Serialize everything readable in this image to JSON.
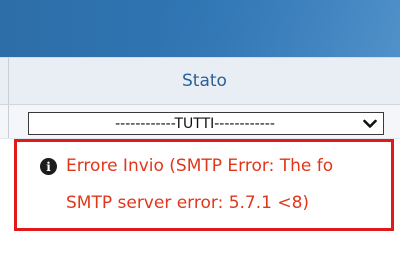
{
  "table": {
    "column_header": "Stato",
    "filter": {
      "selected_value": "------------TUTTI------------"
    }
  },
  "error": {
    "line1": "Errore Invio (SMTP Error: The fo",
    "line2": "SMTP server error: 5.7.1 <8)",
    "icon": "info-circle-icon",
    "text_color": "#e2361a",
    "highlight_color": "#e01a1a"
  },
  "colors": {
    "header_blue": "#2f76b5",
    "column_header_text": "#2c5f98"
  }
}
